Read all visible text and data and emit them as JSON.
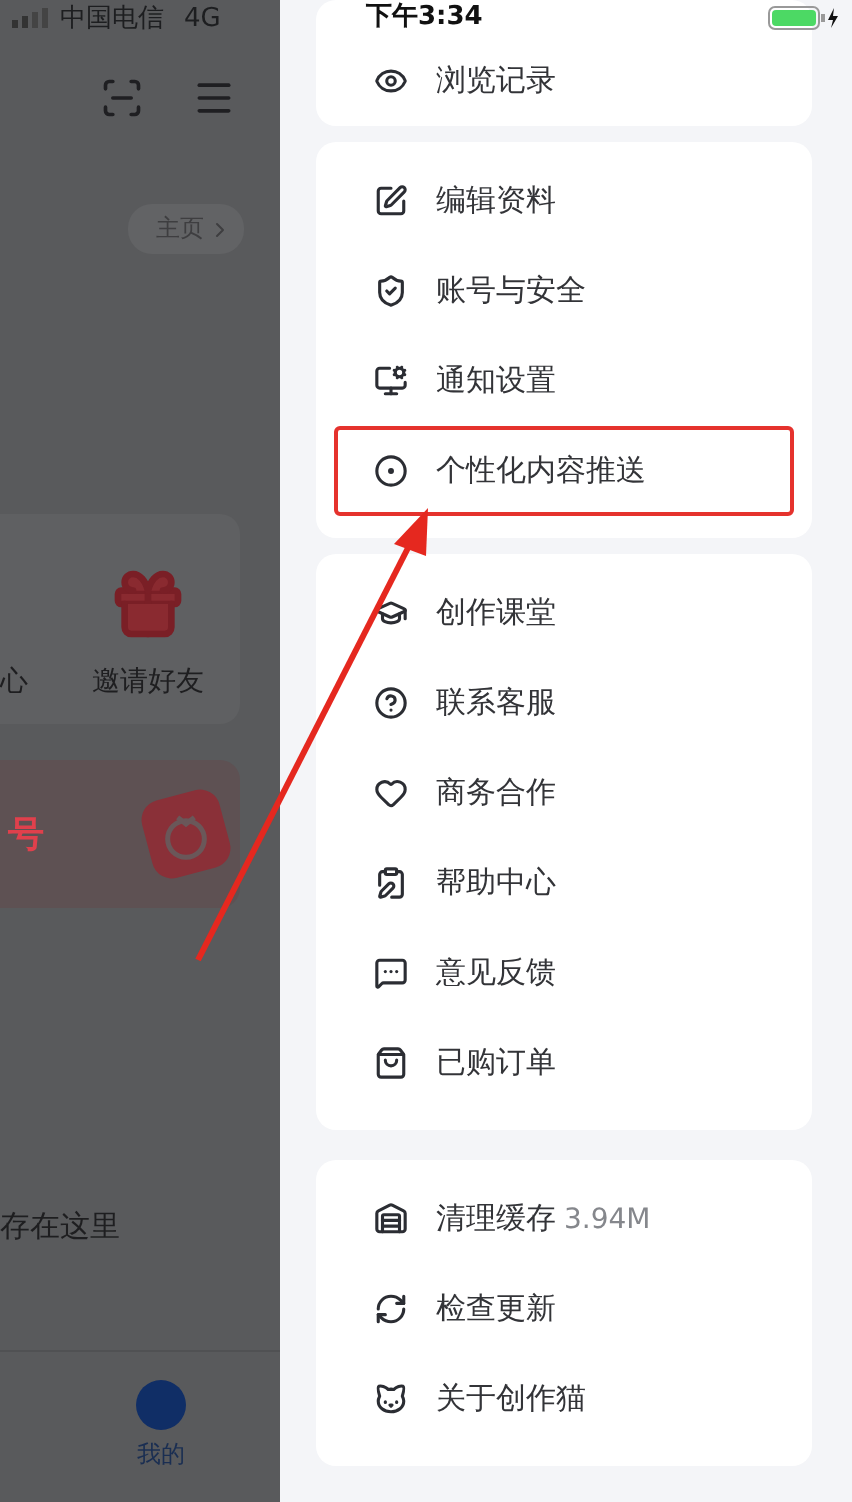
{
  "status_bar": {
    "carrier": "中国电信",
    "network": "4G",
    "time": "下午3:34"
  },
  "background_page": {
    "home_link": "主页",
    "shortcuts": [
      "心",
      "邀请好友"
    ],
    "banner_title": "号",
    "empty_hint": "存在这里",
    "nav_tab": "我的"
  },
  "drawer": {
    "groups": [
      {
        "items": [
          {
            "label": "浏览记录",
            "highlighted": false
          }
        ]
      },
      {
        "items": [
          {
            "label": "编辑资料",
            "highlighted": false
          },
          {
            "label": "账号与安全",
            "highlighted": false
          },
          {
            "label": "通知设置",
            "highlighted": false
          },
          {
            "label": "个性化内容推送",
            "highlighted": true
          }
        ]
      },
      {
        "items": [
          {
            "label": "创作课堂",
            "highlighted": false
          },
          {
            "label": "联系客服",
            "highlighted": false
          },
          {
            "label": "商务合作",
            "highlighted": false
          },
          {
            "label": "帮助中心",
            "highlighted": false
          },
          {
            "label": "意见反馈",
            "highlighted": false
          },
          {
            "label": "已购订单",
            "highlighted": false
          }
        ]
      },
      {
        "items": [
          {
            "label": "清理缓存",
            "detail": "3.94M",
            "highlighted": false
          },
          {
            "label": "检查更新",
            "highlighted": false
          },
          {
            "label": "关于创作猫",
            "highlighted": false
          }
        ]
      }
    ]
  }
}
